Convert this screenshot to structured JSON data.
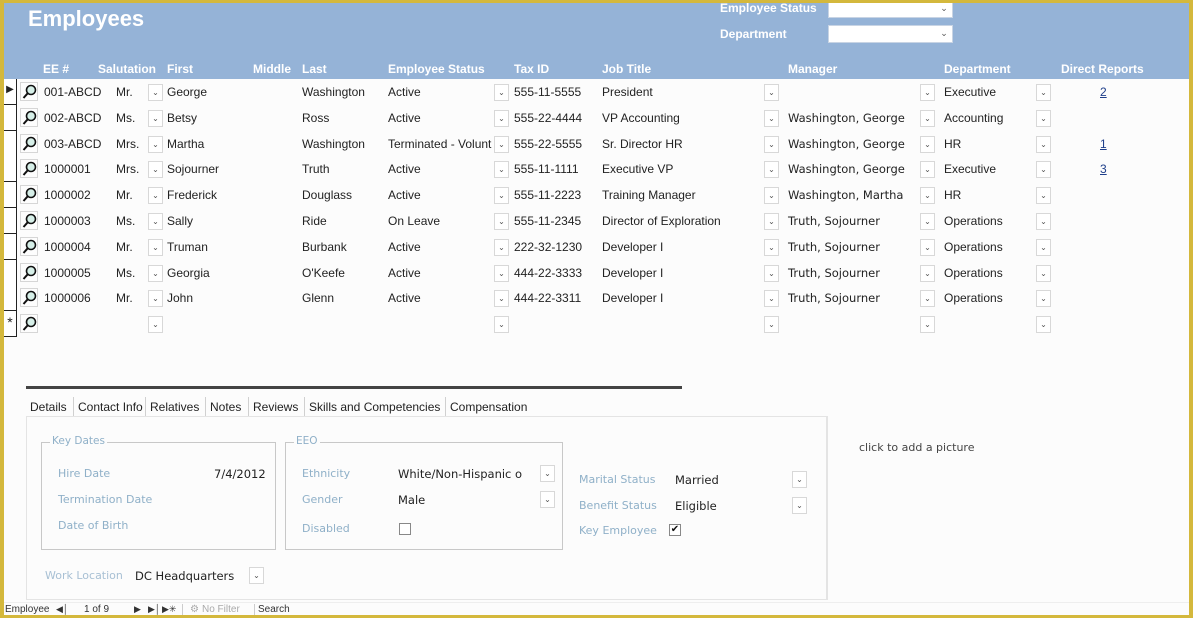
{
  "header": {
    "title": "Employees",
    "filters": [
      {
        "label": "Employee Status",
        "value": ""
      },
      {
        "label": "Department",
        "value": ""
      }
    ]
  },
  "icons": {
    "record_selector_current": "play-triangle-icon",
    "record_selector_new": "asterisk-icon",
    "open_record": "magnifier-icon",
    "dropdown": "chevron-down-icon"
  },
  "columns": [
    "EE #",
    "Salutation",
    "First",
    "Middle",
    "Last",
    "Employee Status",
    "Tax ID",
    "Job Title",
    "Manager",
    "Department",
    "Direct Reports"
  ],
  "rows": [
    {
      "ee": "001-ABCD",
      "salutation": "Mr.",
      "first": "George",
      "middle": "",
      "last": "Washington",
      "status": "Active",
      "tax_id": "555-11-5555",
      "job_title": "President",
      "manager": "",
      "department": "Executive",
      "direct_reports": "2"
    },
    {
      "ee": "002-ABCD",
      "salutation": "Ms.",
      "first": "Betsy",
      "middle": "",
      "last": "Ross",
      "status": "Active",
      "tax_id": "555-22-4444",
      "job_title": "VP Accounting",
      "manager": "Washington, George",
      "department": "Accounting",
      "direct_reports": ""
    },
    {
      "ee": "003-ABCD",
      "salutation": "Mrs.",
      "first": "Martha",
      "middle": "",
      "last": "Washington",
      "status": "Terminated - Volunt",
      "tax_id": "555-22-5555",
      "job_title": "Sr. Director HR",
      "manager": "Washington, George",
      "department": "HR",
      "direct_reports": "1"
    },
    {
      "ee": "1000001",
      "salutation": "Mrs.",
      "first": "Sojourner",
      "middle": "",
      "last": "Truth",
      "status": "Active",
      "tax_id": "555-11-1111",
      "job_title": "Executive VP",
      "manager": "Washington, George",
      "department": "Executive",
      "direct_reports": "3"
    },
    {
      "ee": "1000002",
      "salutation": "Mr.",
      "first": "Frederick",
      "middle": "",
      "last": "Douglass",
      "status": "Active",
      "tax_id": "555-11-2223",
      "job_title": "Training Manager",
      "manager": "Washington, Martha",
      "department": "HR",
      "direct_reports": ""
    },
    {
      "ee": "1000003",
      "salutation": "Ms.",
      "first": "Sally",
      "middle": "",
      "last": "Ride",
      "status": "On Leave",
      "tax_id": "555-11-2345",
      "job_title": "Director of Exploration",
      "manager": "Truth, Sojourner",
      "department": "Operations",
      "direct_reports": ""
    },
    {
      "ee": "1000004",
      "salutation": "Mr.",
      "first": "Truman",
      "middle": "",
      "last": "Burbank",
      "status": "Active",
      "tax_id": "222-32-1230",
      "job_title": "Developer I",
      "manager": "Truth, Sojourner",
      "department": "Operations",
      "direct_reports": ""
    },
    {
      "ee": "1000005",
      "salutation": "Ms.",
      "first": "Georgia",
      "middle": "",
      "last": "O'Keefe",
      "status": "Active",
      "tax_id": "444-22-3333",
      "job_title": "Developer I",
      "manager": "Truth, Sojourner",
      "department": "Operations",
      "direct_reports": ""
    },
    {
      "ee": "1000006",
      "salutation": "Mr.",
      "first": "John",
      "middle": "",
      "last": "Glenn",
      "status": "Active",
      "tax_id": "444-22-3311",
      "job_title": "Developer I",
      "manager": "Truth, Sojourner",
      "department": "Operations",
      "direct_reports": ""
    }
  ],
  "new_row_marker": "*",
  "tabs": [
    "Details",
    "Contact Info",
    "Relatives",
    "Notes",
    "Reviews",
    "Skills and Competencies",
    "Compensation"
  ],
  "details": {
    "key_dates": {
      "title": "Key Dates",
      "hire_date_label": "Hire Date",
      "hire_date": "7/4/2012",
      "termination_label": "Termination Date",
      "termination_date": "",
      "dob_label": "Date of Birth",
      "dob": ""
    },
    "eeo": {
      "title": "EEO",
      "ethnicity_label": "Ethnicity",
      "ethnicity": "White/Non-Hispanic o",
      "gender_label": "Gender",
      "gender": "Male",
      "disabled_label": "Disabled",
      "disabled": false
    },
    "marital_status_label": "Marital Status",
    "marital_status": "Married",
    "benefit_status_label": "Benefit Status",
    "benefit_status": "Eligible",
    "key_employee_label": "Key Employee",
    "key_employee": true,
    "work_location_label": "Work Location",
    "work_location": "DC Headquarters",
    "picture_prompt": "click to add a picture"
  },
  "statusbar": {
    "record_label": "Employee",
    "position": "1 of 9",
    "filter": "No Filter",
    "search": "Search"
  }
}
